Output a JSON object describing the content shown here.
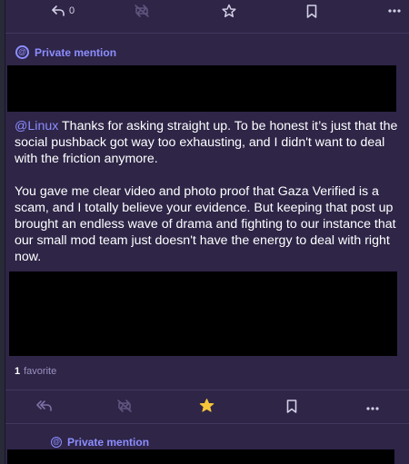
{
  "top_actions": {
    "reply_count": "0",
    "icons": [
      "reply-icon",
      "boost-disabled-icon",
      "star-icon",
      "bookmark-icon",
      "more-icon"
    ]
  },
  "post": {
    "visibility_label": "Private mention",
    "mention_handle": "@Linux",
    "paragraph_1": "Thanks for asking straight up. To be honest it’s just that the social pushback got way too exhausting, and I didn't want to deal with the friction anymore.",
    "paragraph_2": "You gave me clear video and photo proof that Gaza Verified is a scam, and I totally believe your evidence. But keeping that post up brought an endless wave of drama and fighting to our instance that our small mod team just doesn't have the energy to deal with right now.",
    "favourite_count": "1",
    "favourite_label": "favorite"
  },
  "bottom_actions": {
    "icons": [
      "reply-all-icon",
      "boost-disabled-icon",
      "star-filled-icon",
      "bookmark-icon",
      "more-icon"
    ],
    "favourited_color": "#f5c53a"
  },
  "next_post": {
    "visibility_label": "Private mention"
  },
  "colors": {
    "background": "#2e2547",
    "accent": "#8c8dff",
    "icon": "#7d72a5",
    "redaction": "#000000"
  }
}
